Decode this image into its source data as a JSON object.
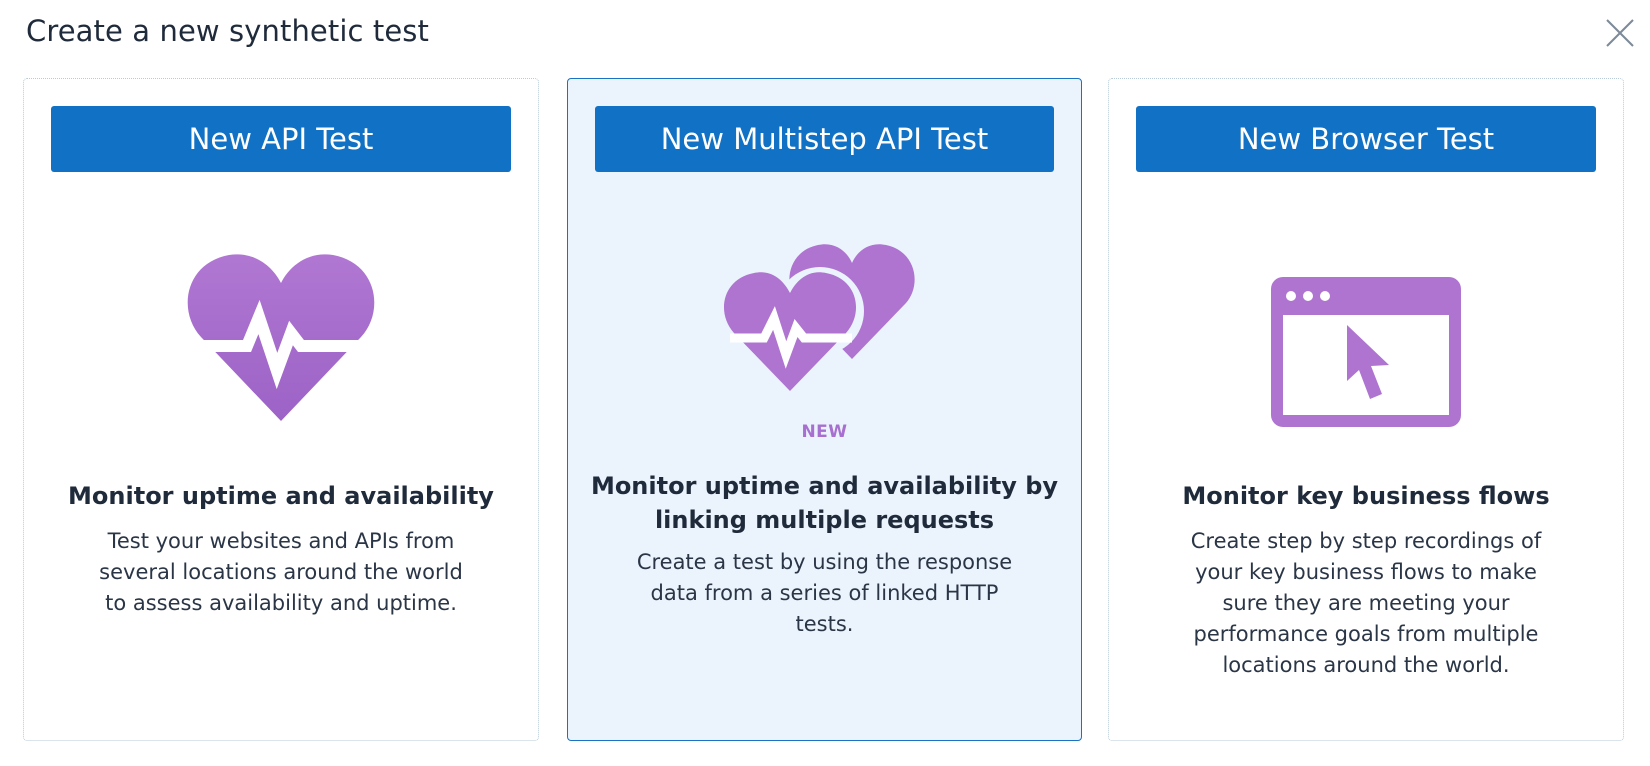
{
  "dialog": {
    "title": "Create a new synthetic test",
    "close_icon": "close-icon"
  },
  "colors": {
    "button_bg": "#1171c4",
    "icon_purple": "#ae74d0",
    "selected_card_bg": "#ebf4fc",
    "selected_card_border": "#1a72c4"
  },
  "cards": [
    {
      "button_label": "New API Test",
      "icon": "heart-pulse-icon",
      "heading_lines": [
        "Monitor uptime and availability"
      ],
      "description_lines": [
        "Test your websites and APIs from",
        "several locations around the world",
        "to assess availability and uptime."
      ],
      "selected": false
    },
    {
      "button_label": "New Multistep API Test",
      "icon": "linked-hearts-icon",
      "badge": "NEW",
      "heading_lines": [
        "Monitor uptime and availability by",
        "linking multiple requests"
      ],
      "description_lines": [
        "Create a test by using the response",
        "data from a series of linked HTTP",
        "tests."
      ],
      "selected": true
    },
    {
      "button_label": "New Browser Test",
      "icon": "browser-cursor-icon",
      "heading_lines": [
        "Monitor key business flows"
      ],
      "description_lines": [
        "Create step by step recordings of",
        "your key business flows to make",
        "sure they are meeting your",
        "performance goals from multiple",
        "locations around the world."
      ],
      "selected": false
    }
  ]
}
